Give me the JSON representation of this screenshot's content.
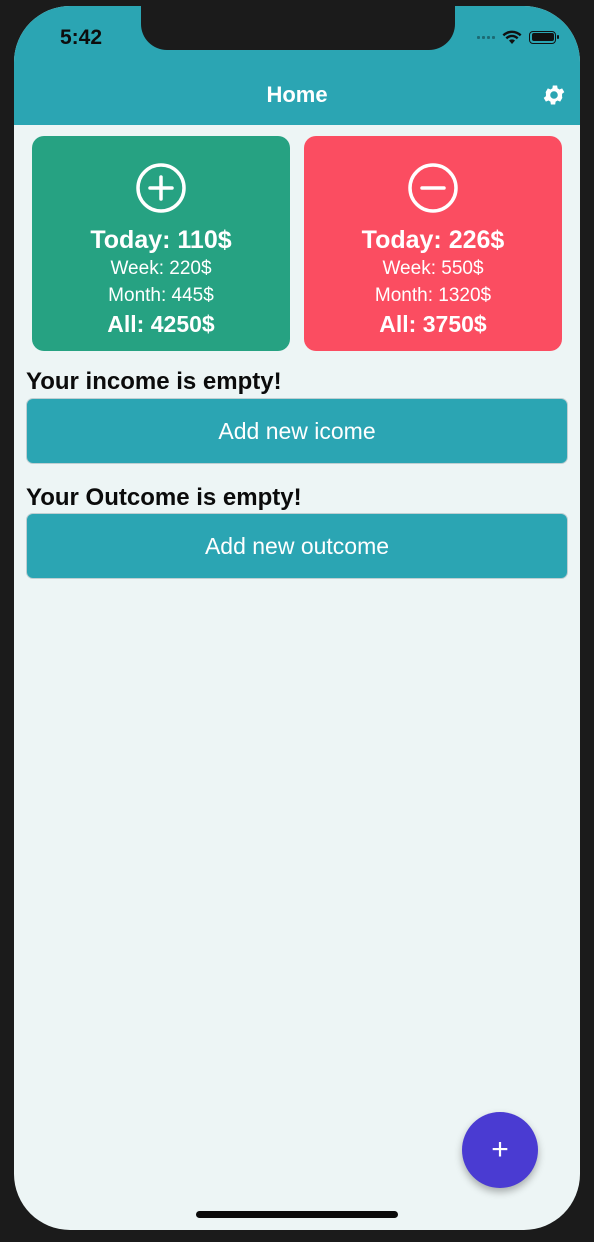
{
  "status_bar": {
    "time": "5:42"
  },
  "header": {
    "title": "Home",
    "settings_icon": "gear-icon",
    "color": "#2ba5b3"
  },
  "income_card": {
    "icon": "plus-circle-icon",
    "today": "Today: 110$",
    "week": "Week: 220$",
    "month": "Month: 445$",
    "all": "All: 4250$",
    "color": "#26a282"
  },
  "outcome_card": {
    "icon": "minus-circle-icon",
    "today": "Today: 226$",
    "week": "Week: 550$",
    "month": "Month: 1320$",
    "all": "All: 3750$",
    "color": "#fb4d61"
  },
  "income_section": {
    "empty_text": "Your income is empty!",
    "add_button": "Add new icome"
  },
  "outcome_section": {
    "empty_text": "Your Outcome is empty!",
    "add_button": "Add new outcome"
  },
  "fab": {
    "label": "+",
    "icon": "plus-icon",
    "color": "#4a3bd2"
  }
}
